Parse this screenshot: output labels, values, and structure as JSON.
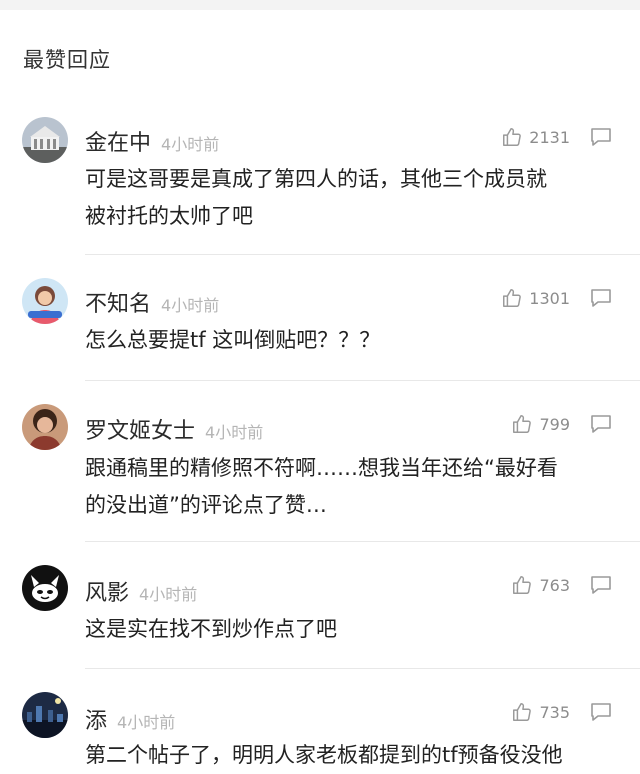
{
  "section_title": "最赞回应",
  "comments": [
    {
      "name": "金在中",
      "time": "4小时前",
      "likes": "2131",
      "avatar": "building-avatar",
      "lines": [
        "可是这哥要是真成了第四人的话，其他三个成员就",
        "被衬托的太帅了吧"
      ]
    },
    {
      "name": "不知名",
      "time": "4小时前",
      "likes": "1301",
      "avatar": "woman-avatar",
      "lines": [
        "怎么总要提tf 这叫倒贴吧？？？"
      ]
    },
    {
      "name": "罗文姬女士",
      "time": "4小时前",
      "likes": "799",
      "avatar": "lady-avatar",
      "lines": [
        "跟通稿里的精修照不符啊……想我当年还给“最好看",
        "的没出道”的评论点了赞…"
      ]
    },
    {
      "name": "风影",
      "time": "4小时前",
      "likes": "763",
      "avatar": "cat-avatar",
      "lines": [
        "这是实在找不到炒作点了吧"
      ]
    },
    {
      "name": "添",
      "time": "4小时前",
      "likes": "735",
      "avatar": "night-city-avatar",
      "lines": [
        "第二个帖子了，明明人家老板都提到的tf预备役没他"
      ]
    }
  ]
}
